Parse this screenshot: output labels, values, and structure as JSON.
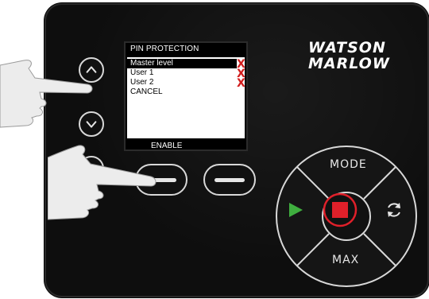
{
  "screen": {
    "title": "PIN PROTECTION",
    "menu_items": [
      {
        "label": "Master level",
        "selected": true,
        "status": "X"
      },
      {
        "label": "User 1",
        "selected": false,
        "status": "X"
      },
      {
        "label": "User 2",
        "selected": false,
        "status": "X"
      },
      {
        "label": "CANCEL",
        "selected": false,
        "status": ""
      }
    ],
    "softkey_label": "ENABLE"
  },
  "brand": {
    "line1": "WATSON",
    "line2": "MARLOW"
  },
  "keypad": {
    "mode_label": "MODE",
    "max_label": "MAX"
  },
  "colors": {
    "panel": "#0e0e0e",
    "stop": "#e0202a",
    "start": "#3fae3f",
    "x_mark": "#d21e1e"
  },
  "icons": [
    "up-arrow-icon",
    "down-arrow-icon",
    "back-icon",
    "play-icon",
    "stop-icon",
    "refresh-icon"
  ]
}
